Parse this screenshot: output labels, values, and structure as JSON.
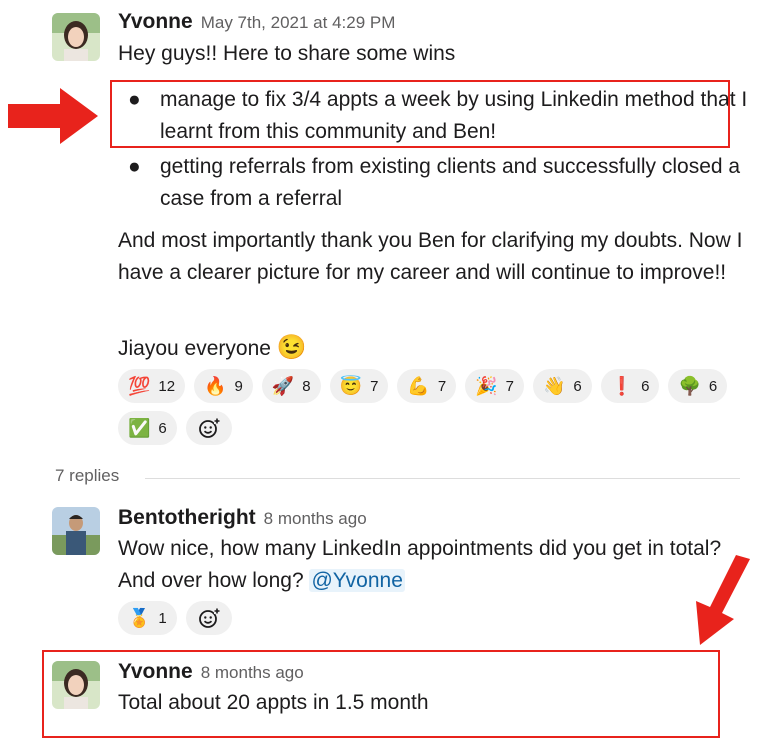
{
  "messages": [
    {
      "author": "Yvonne",
      "time": "May 7th, 2021 at 4:29 PM",
      "intro": "Hey guys!! Here to share some wins",
      "bullets": [
        "manage to fix 3/4 appts a week by using Linkedin method that I learnt from this community and Ben!",
        "getting referrals from existing clients and successfully closed a case from a referral"
      ],
      "paragraph": "And most importantly thank you Ben for clarifying my doubts. Now I have a clearer picture for my career and will continue to improve!!",
      "closing": "Jiayou everyone",
      "closing_emoji": "😉",
      "reactions": [
        {
          "emoji": "💯",
          "count": "12"
        },
        {
          "emoji": "🔥",
          "count": "9"
        },
        {
          "emoji": "🚀",
          "count": "8"
        },
        {
          "emoji": "😇",
          "count": "7"
        },
        {
          "emoji": "💪",
          "count": "7"
        },
        {
          "emoji": "🎉",
          "count": "7"
        },
        {
          "emoji": "👋",
          "count": "6"
        },
        {
          "emoji": "❗",
          "count": "6"
        },
        {
          "emoji": "🌳",
          "count": "6"
        },
        {
          "emoji": "✅",
          "count": "6"
        }
      ]
    }
  ],
  "thread": {
    "replies_label": "7 replies"
  },
  "replies": [
    {
      "author": "Bentotheright",
      "time": "8 months ago",
      "text": "Wow nice, how many LinkedIn appointments  did you get in total? And over how long?",
      "mention": "@Yvonne",
      "reactions": [
        {
          "emoji": "🏅",
          "count": "1"
        }
      ]
    },
    {
      "author": "Yvonne",
      "time": "8 months ago",
      "text": "Total about 20 appts in 1.5 month"
    }
  ],
  "icons": {
    "add_reaction": "add-reaction-icon"
  },
  "colors": {
    "annotation_red": "#e8231c",
    "mention_blue": "#1264a3",
    "reaction_bg": "#f0f0f0"
  }
}
